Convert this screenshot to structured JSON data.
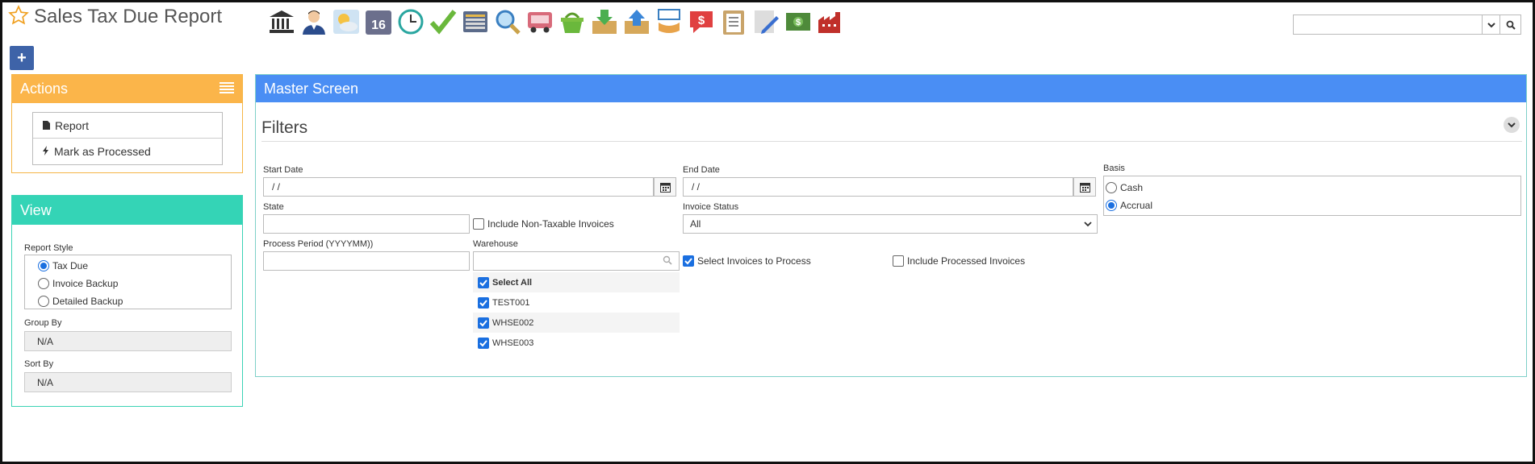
{
  "page": {
    "title": "Sales Tax Due Report"
  },
  "toolbar": {
    "icons": [
      "bank-icon",
      "user-icon",
      "weather-icon",
      "calendar-16-icon",
      "clock-icon",
      "checkmark-icon",
      "keyboard-icon",
      "magnifier-icon",
      "truck-icon",
      "basket-icon",
      "download-box-icon",
      "upload-box-icon",
      "sign-hand-icon",
      "speech-dollar-icon",
      "clipboard-icon",
      "pencil-icon",
      "cash-icon",
      "factory-icon"
    ],
    "calendar_day": "16"
  },
  "top_search": {
    "value": ""
  },
  "actions": {
    "title": "Actions",
    "items": [
      {
        "label": "Report",
        "icon": "document-icon"
      },
      {
        "label": "Mark as Processed",
        "icon": "lightning-icon"
      }
    ]
  },
  "view": {
    "title": "View",
    "report_style_label": "Report Style",
    "report_styles": [
      "Tax Due",
      "Invoice Backup",
      "Detailed Backup"
    ],
    "report_style_selected": 0,
    "group_by_label": "Group By",
    "group_by_value": "N/A",
    "sort_by_label": "Sort By",
    "sort_by_value": "N/A"
  },
  "master": {
    "title": "Master Screen",
    "filters_title": "Filters",
    "start_date_label": "Start Date",
    "start_date_value": " /  /",
    "end_date_label": "End Date",
    "end_date_value": " /  /",
    "basis_label": "Basis",
    "basis_options": [
      "Cash",
      "Accrual"
    ],
    "basis_selected": 1,
    "state_label": "State",
    "state_value": "",
    "include_nontaxable_label": "Include Non-Taxable Invoices",
    "include_nontaxable_checked": false,
    "invoice_status_label": "Invoice Status",
    "invoice_status_value": "All",
    "process_period_label": "Process Period (YYYYMM))",
    "process_period_value": "",
    "warehouse_label": "Warehouse",
    "warehouse_search": "",
    "warehouses": [
      {
        "label": "Select All",
        "checked": true
      },
      {
        "label": "TEST001",
        "checked": true
      },
      {
        "label": "WHSE002",
        "checked": true
      },
      {
        "label": "WHSE003",
        "checked": true
      }
    ],
    "select_invoices_label": "Select Invoices to Process",
    "select_invoices_checked": true,
    "include_processed_label": "Include Processed Invoices",
    "include_processed_checked": false
  },
  "colors": {
    "actions": "#fbb54a",
    "view": "#34d4b6",
    "master": "#4a8ef4",
    "accent": "#1a6fe0"
  }
}
